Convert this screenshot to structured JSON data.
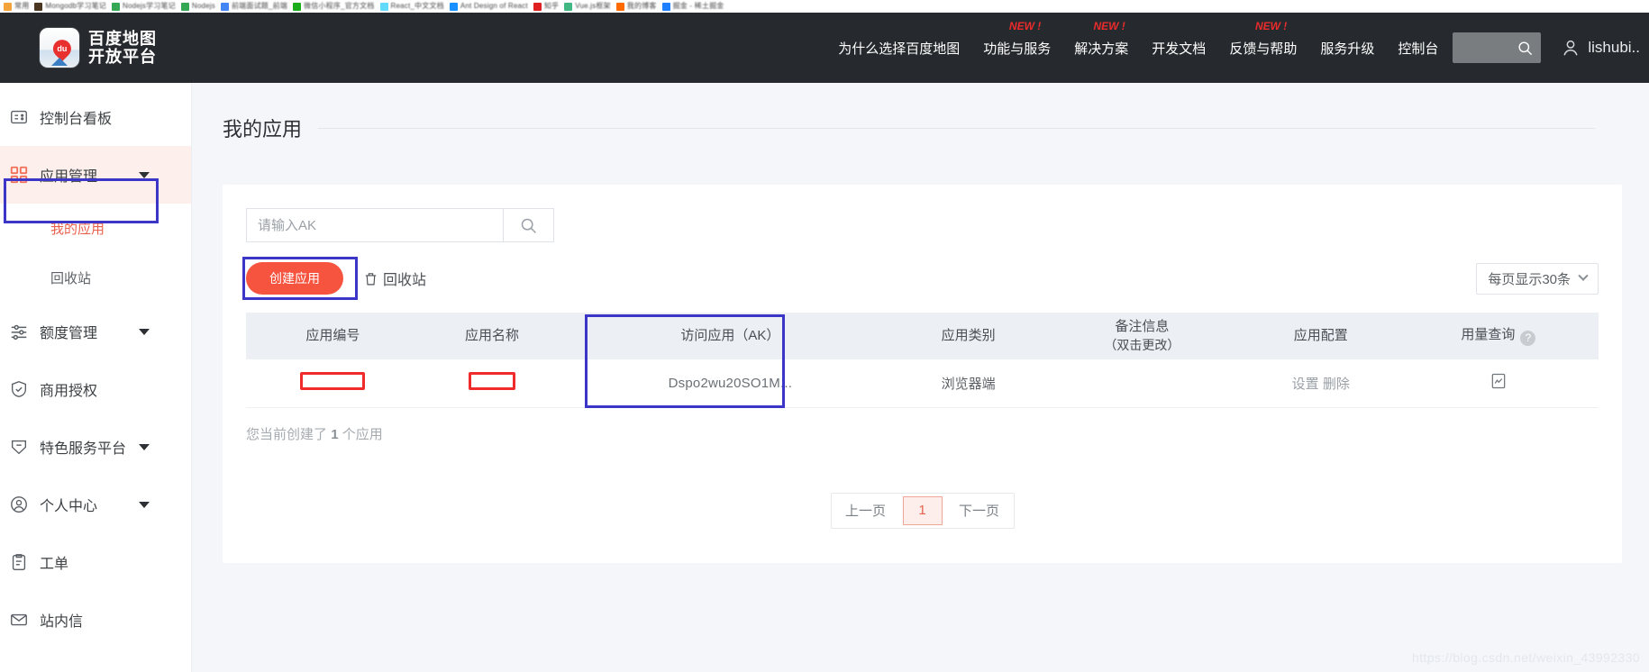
{
  "browser": {
    "bookmarks": [
      {
        "label": "常用",
        "color": "#f4a23a"
      },
      {
        "label": "Mongodb学习笔记",
        "color": "#4b3621"
      },
      {
        "label": "Nodejs学习笔记",
        "color": "#34a853"
      },
      {
        "label": "Nodejs",
        "color": "#34a853"
      },
      {
        "label": "前端面试题_前端",
        "color": "#4285f4"
      },
      {
        "label": "微信小程序_官方文档",
        "color": "#1aad19"
      },
      {
        "label": "React_中文文档",
        "color": "#61dafb"
      },
      {
        "label": "Ant Design of React",
        "color": "#1890ff"
      },
      {
        "label": "知乎",
        "color": "#e02020"
      },
      {
        "label": "Vue.js框架",
        "color": "#41b883"
      },
      {
        "label": "我的博客",
        "color": "#ff6a00"
      },
      {
        "label": "掘金 - 稀土掘金",
        "color": "#1e80ff"
      }
    ]
  },
  "header": {
    "logo_line1": "百度地图",
    "logo_line2": "开放平台",
    "logo_mark": "du",
    "nav": [
      {
        "label": "为什么选择百度地图",
        "badge": ""
      },
      {
        "label": "功能与服务",
        "badge": "NEW !"
      },
      {
        "label": "解决方案",
        "badge": "NEW !"
      },
      {
        "label": "开发文档",
        "badge": ""
      },
      {
        "label": "反馈与帮助",
        "badge": "NEW !"
      },
      {
        "label": "服务升级",
        "badge": ""
      },
      {
        "label": "控制台",
        "badge": ""
      }
    ],
    "search_placeholder": "",
    "username": "lishubi..",
    "bg_color": "#262a2e"
  },
  "sidebar": {
    "items": [
      {
        "label": "控制台看板",
        "icon": "dashboard-icon",
        "caret": false,
        "active": false
      },
      {
        "label": "应用管理",
        "icon": "apps-grid-icon",
        "caret": true,
        "active": true
      },
      {
        "label": "额度管理",
        "icon": "sliders-icon",
        "caret": true,
        "active": false
      },
      {
        "label": "商用授权",
        "icon": "shield-check-icon",
        "caret": false,
        "active": false
      },
      {
        "label": "特色服务平台",
        "icon": "tag-icon",
        "caret": true,
        "active": false
      },
      {
        "label": "个人中心",
        "icon": "user-circle-icon",
        "caret": true,
        "active": false
      },
      {
        "label": "工单",
        "icon": "clipboard-icon",
        "caret": false,
        "active": false
      },
      {
        "label": "站内信",
        "icon": "mail-icon",
        "caret": false,
        "active": false
      }
    ],
    "submenu": [
      {
        "label": "我的应用",
        "current": true
      },
      {
        "label": "回收站",
        "current": false
      }
    ],
    "accent_color": "#e8614d"
  },
  "main": {
    "page_title": "我的应用",
    "search": {
      "value": "",
      "placeholder": "请输入AK"
    },
    "toolbar": {
      "create_label": "创建应用",
      "recycle_label": "回收站",
      "per_page_label": "每页显示30条"
    },
    "table": {
      "columns": [
        {
          "label": "应用编号",
          "sub": ""
        },
        {
          "label": "应用名称",
          "sub": ""
        },
        {
          "label": "访问应用（AK）",
          "sub": ""
        },
        {
          "label": "应用类别",
          "sub": ""
        },
        {
          "label": "备注信息",
          "sub": "（双击更改）"
        },
        {
          "label": "应用配置",
          "sub": ""
        },
        {
          "label": "用量查询",
          "sub": ""
        }
      ],
      "rows": [
        {
          "app_id": "",
          "app_name": "",
          "ak": "Dspo2wu20SO1M...",
          "category": "浏览器端",
          "remark": "",
          "config_settings": "设置",
          "config_delete": "删除",
          "usage_icon": "chart-icon"
        }
      ]
    },
    "count_text_prefix": "您当前创建了",
    "count_value": "1",
    "count_text_suffix": "个应用",
    "pagination": {
      "prev": "上一页",
      "current": "1",
      "next": "下一页"
    }
  },
  "watermark": "https://blog.csdn.net/weixin_43992330",
  "annotation_color": "#3b36c8"
}
